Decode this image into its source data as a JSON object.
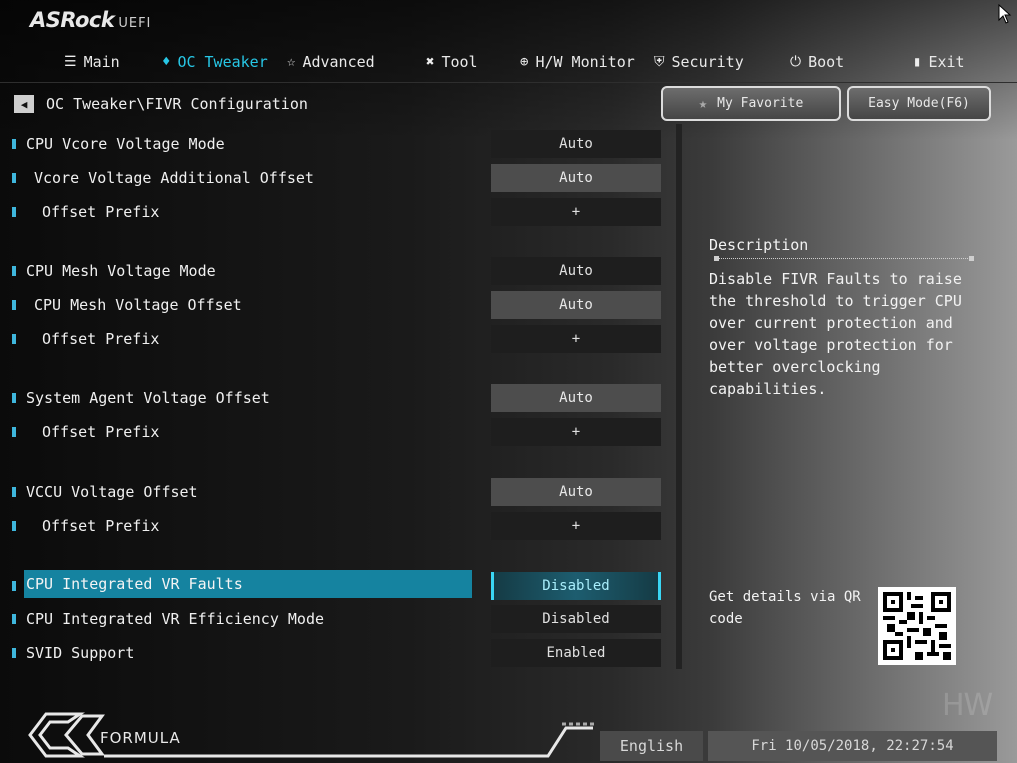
{
  "brand": {
    "logo": "ASRock",
    "suffix": "UEFI"
  },
  "tabs": [
    {
      "label": "Main",
      "icon": "list-icon"
    },
    {
      "label": "OC Tweaker",
      "icon": "flame-icon",
      "active": true
    },
    {
      "label": "Advanced",
      "icon": "star-icon"
    },
    {
      "label": "Tool",
      "icon": "tools-icon"
    },
    {
      "label": "H/W Monitor",
      "icon": "crosshair-icon"
    },
    {
      "label": "Security",
      "icon": "shield-icon"
    },
    {
      "label": "Boot",
      "icon": "power-icon"
    },
    {
      "label": "Exit",
      "icon": "exit-icon"
    }
  ],
  "breadcrumb": "OC Tweaker\\FIVR Configuration",
  "buttons": {
    "favorite": "My Favorite",
    "easy_mode": "Easy Mode(F6)"
  },
  "settings": [
    {
      "label": "CPU Vcore Voltage Mode",
      "value": "Auto"
    },
    {
      "label": "Vcore Voltage Additional Offset",
      "value": "Auto"
    },
    {
      "label": "Offset Prefix",
      "value": "+"
    },
    {
      "label": "CPU Mesh Voltage Mode",
      "value": "Auto"
    },
    {
      "label": "CPU Mesh Voltage Offset",
      "value": "Auto"
    },
    {
      "label": "Offset Prefix",
      "value": "+"
    },
    {
      "label": "System Agent Voltage Offset",
      "value": "Auto"
    },
    {
      "label": "Offset Prefix",
      "value": "+"
    },
    {
      "label": "VCCU Voltage Offset",
      "value": "Auto"
    },
    {
      "label": "Offset Prefix",
      "value": "+"
    },
    {
      "label": "CPU Integrated VR Faults",
      "value": "Disabled",
      "selected": true
    },
    {
      "label": "CPU Integrated VR Efficiency Mode",
      "value": "Disabled"
    },
    {
      "label": "SVID Support",
      "value": "Enabled"
    }
  ],
  "description": {
    "title": "Description",
    "text": "Disable FIVR Faults to raise the threshold to trigger CPU over current protection and over voltage protection for better overclocking capabilities."
  },
  "qr": {
    "text": "Get details via QR code"
  },
  "footer": {
    "brand": "FORMULA",
    "language": "English",
    "datetime": "Fri 10/05/2018, 22:27:54"
  },
  "watermark": "HW",
  "colors": {
    "accent": "#27c7e6",
    "selected_row": "#1583a0"
  }
}
